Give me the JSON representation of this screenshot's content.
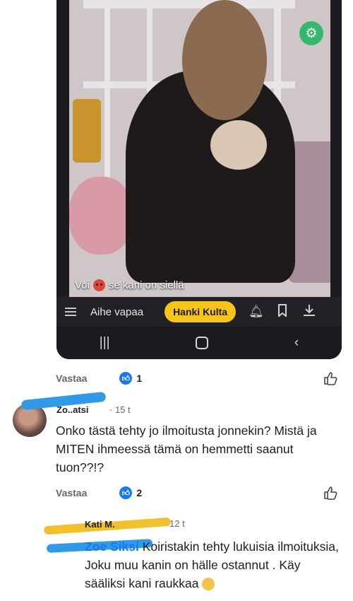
{
  "embedded": {
    "caption_pre": "Voi",
    "caption_post": "se kani on siellä",
    "toolbar": {
      "topic": "Aihe vapaa",
      "gold_button": "Hanki Kulta"
    }
  },
  "comments": [
    {
      "reply_label": "Vastaa",
      "likes": "1"
    },
    {
      "author": "Zo..atsi",
      "time": "15 t",
      "text": "Onko tästä tehty jo ilmoitusta jonnekin? Mistä ja MITEN ihmeessä tämä on hemmetti saanut tuon??!?",
      "reply_label": "Vastaa",
      "likes": "2"
    },
    {
      "author": "Kati M.",
      "time": "12 t",
      "mention": "Zoe Siksi",
      "text": "Koiristakin tehty lukuisia ilmoituksia, Joku muu kanin on hälle ostannut . Käy sääliksi kani raukkaa"
    }
  ],
  "colors": {
    "like_blue": "#1877f2",
    "gold": "#f5c518",
    "badge_green": "#35b86a"
  }
}
